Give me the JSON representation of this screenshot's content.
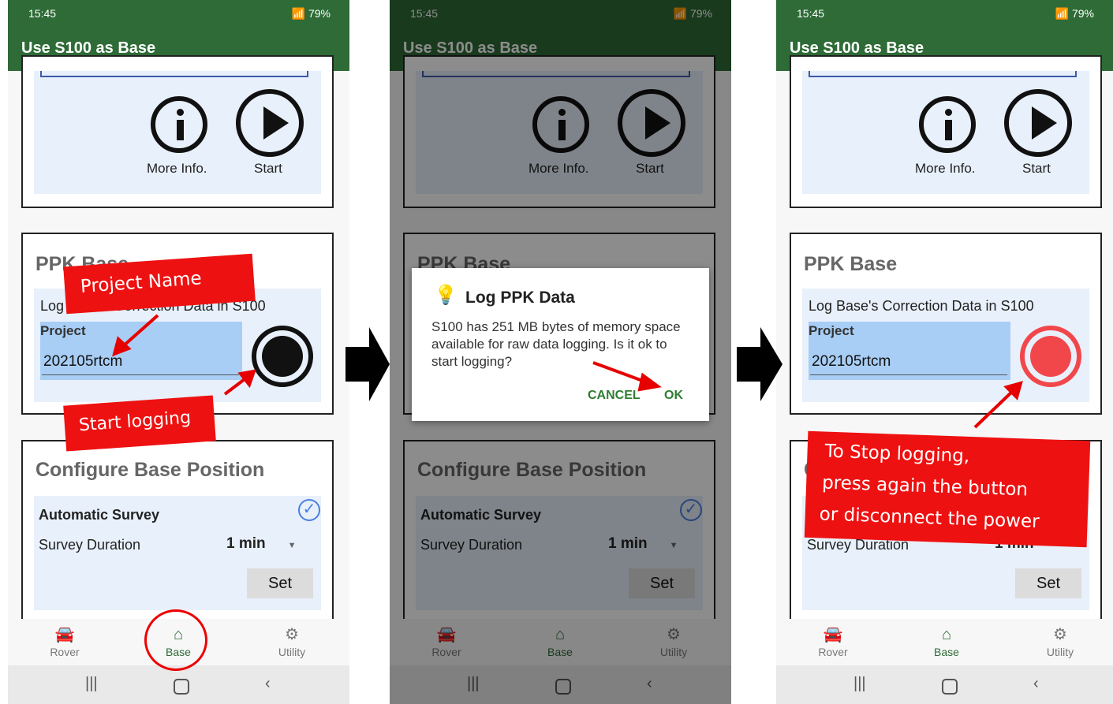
{
  "status": {
    "time": "15:45",
    "battery": "79%"
  },
  "app_title": "Use S100 as Base",
  "more_info_label": "More Info.",
  "start_label": "Start",
  "ppk": {
    "title": "PPK Base",
    "subtitle": "Log Base's Correction Data in S100",
    "project_label": "Project",
    "project_value": "202105rtcm"
  },
  "configure": {
    "title": "Configure Base Position",
    "automatic_survey": "Automatic Survey",
    "survey_duration_label": "Survey Duration",
    "survey_duration_value": "1 min",
    "set_label": "Set"
  },
  "nav": {
    "rover": "Rover",
    "base": "Base",
    "utility": "Utility"
  },
  "dialog": {
    "title": "Log PPK Data",
    "message": "S100 has 251 MB bytes of memory space available for raw data logging. Is it ok to start logging?",
    "cancel": "CANCEL",
    "ok": "OK"
  },
  "callouts": {
    "project_name": "Project Name",
    "start_logging": "Start logging",
    "stop_line1": "To Stop logging,",
    "stop_line2": "press again the button",
    "stop_line3": "or disconnect the power"
  },
  "colors": {
    "brand": "#2e6b36",
    "annotation": "#ee1111",
    "recording": "#f2474a",
    "project_bg": "#a8cef5"
  }
}
